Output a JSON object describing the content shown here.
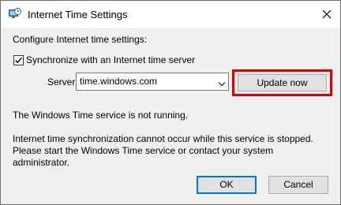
{
  "window": {
    "title": "Internet Time Settings",
    "icon": "clock-globe-icon",
    "close_icon": "close-icon"
  },
  "content": {
    "heading": "Configure Internet time settings:",
    "sync_checkbox": {
      "label": "Synchronize with an Internet time server",
      "checked": true
    },
    "server_label": "Server:",
    "server_value": "time.windows.com",
    "update_button": "Update now",
    "status": "The Windows Time service is not running.",
    "message_lines": [
      "Internet time synchronization cannot occur while this service is stopped.",
      "Please start the Windows Time service or contact your system",
      "administrator."
    ]
  },
  "buttons": {
    "ok": "OK",
    "cancel": "Cancel"
  },
  "colors": {
    "highlight": "#e00000",
    "accent": "#0078d7"
  }
}
